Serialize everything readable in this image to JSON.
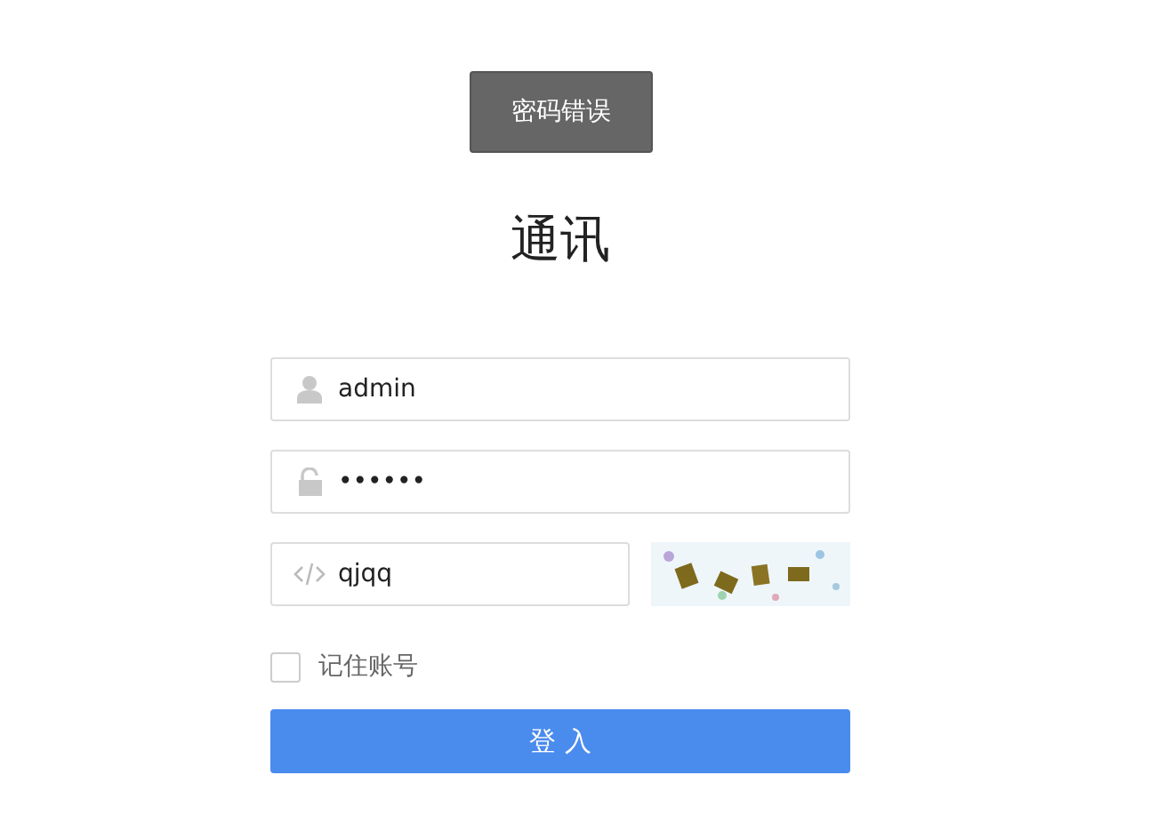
{
  "toast": {
    "text": "密码错误"
  },
  "title": "通讯",
  "fields": [
    {
      "kind": "user",
      "value": "admin"
    },
    {
      "kind": "lock",
      "value": "••••••"
    },
    {
      "kind": "code",
      "value": "qjqq"
    }
  ],
  "remember": {
    "label": "记住账号",
    "checked": false
  },
  "login_button": "登 入"
}
